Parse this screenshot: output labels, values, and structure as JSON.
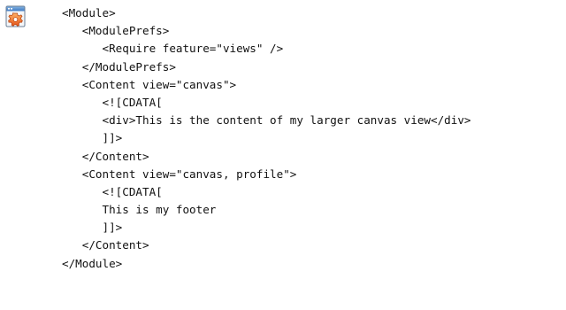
{
  "icon": "gadget-xml-file-icon",
  "code_lines": [
    "<Module>",
    "   <ModulePrefs>",
    "      <Require feature=\"views\" />",
    "   </ModulePrefs>",
    "   <Content view=\"canvas\">",
    "      <![CDATA[",
    "      <div>This is the content of my larger canvas view</div>",
    "      ]]>",
    "   </Content>",
    "   <Content view=\"canvas, profile\">",
    "      <![CDATA[",
    "      This is my footer",
    "      ]]>",
    "   </Content>",
    "</Module>"
  ]
}
